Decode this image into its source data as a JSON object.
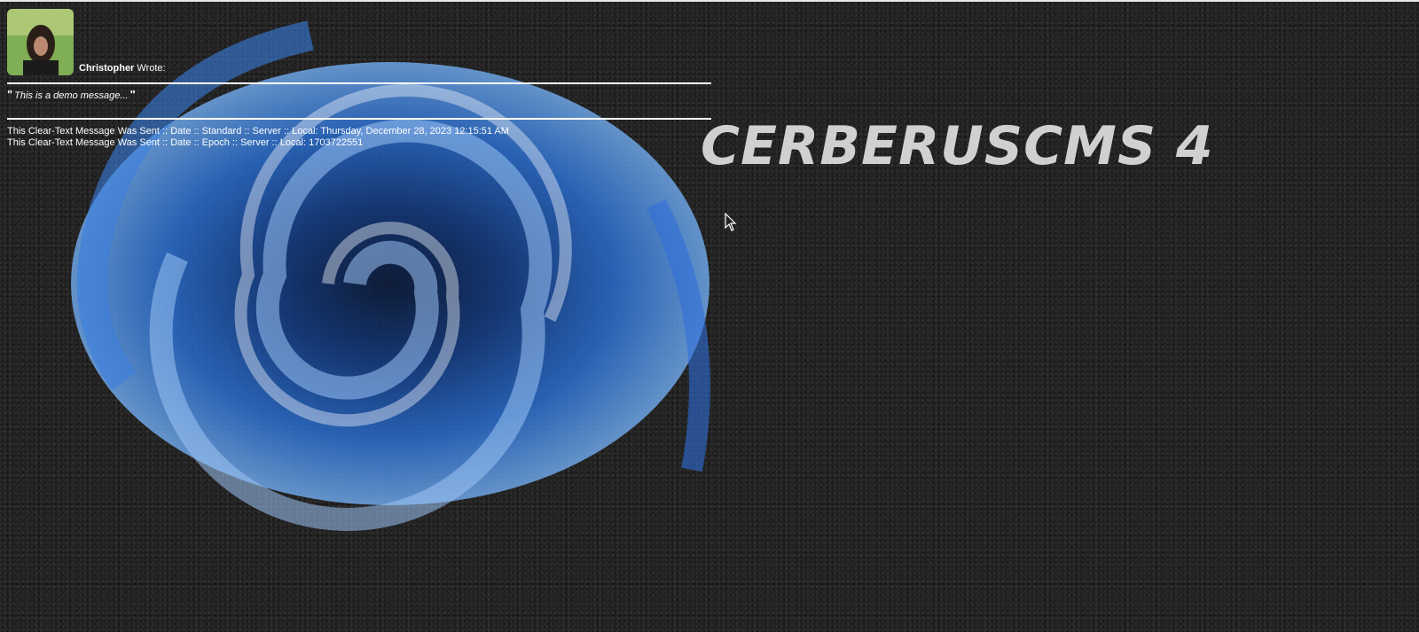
{
  "message": {
    "author": "Christopher",
    "wrote_label": "Wrote:",
    "quote_open": "\"",
    "quote_text": "This is a demo message...",
    "quote_close": "\"",
    "sent_standard": "This Clear-Text Message Was Sent :: Date :: Standard :: Server :: Local: Thursday, December 28, 2023 12:15:51 AM",
    "sent_epoch": "This Clear-Text Message Was Sent :: Date :: Epoch :: Server :: Local: 1703722551"
  },
  "brand": {
    "title": "CERBERUSCMS 4"
  },
  "icons": {
    "avatar": "user-avatar-photo",
    "background": "blue-swirl-artwork",
    "cursor": "mouse-pointer-icon"
  },
  "colors": {
    "background": "#222222",
    "text": "#ffffff",
    "brand": "#d0d0d0",
    "swirl_primary": "#1a4fb0",
    "swirl_light": "#8fb8ee"
  }
}
